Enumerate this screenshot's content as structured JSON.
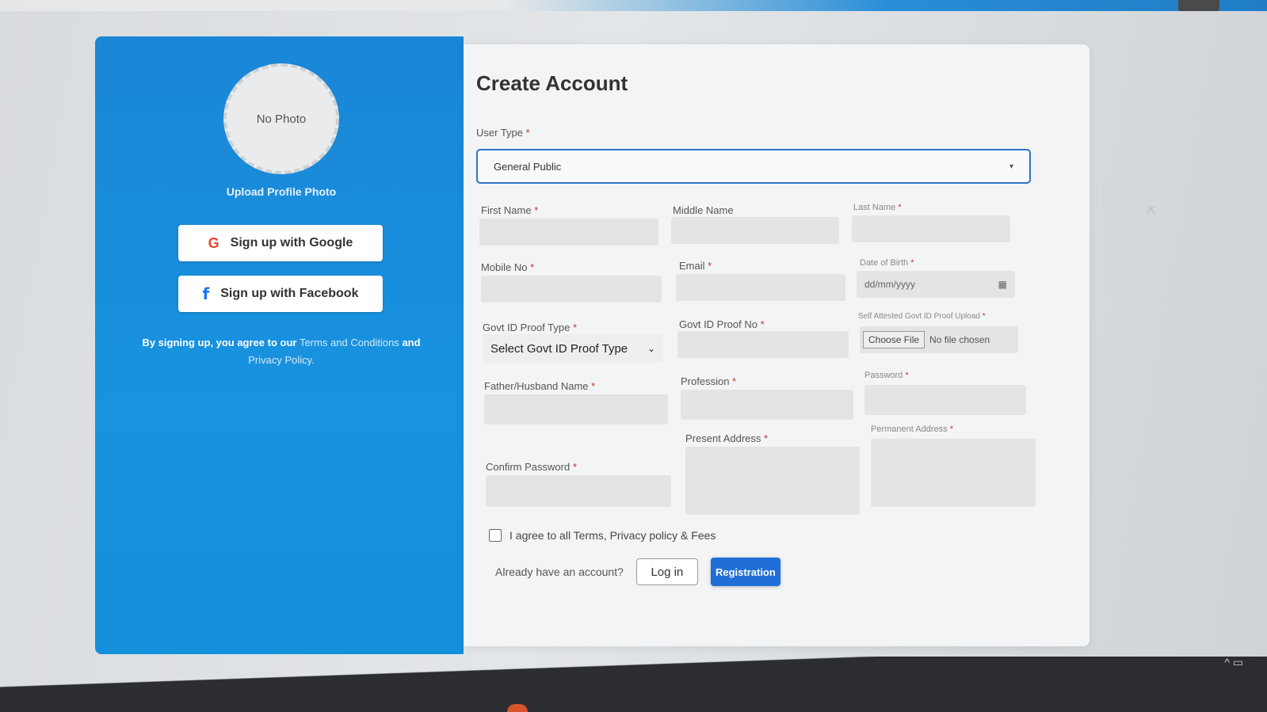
{
  "left_panel": {
    "photo_placeholder": "No Photo",
    "upload_label": "Upload Profile Photo",
    "google_button": "Sign up with Google",
    "google_icon": "G",
    "facebook_button": "Sign up with Facebook",
    "facebook_icon": "f",
    "agree_prefix": "By signing up, you agree to our",
    "terms_link": "Terms and Conditions",
    "agree_and": "and",
    "privacy_link": "Privacy Policy.",
    "accent_color": "#1793df"
  },
  "form": {
    "title": "Create Account",
    "user_type_label": "User Type",
    "user_type_value": "General Public",
    "required_marker": "*",
    "fields": {
      "first_name": "First Name",
      "middle_name": "Middle Name",
      "last_name": "Last Name",
      "mobile_no": "Mobile No",
      "email": "Email",
      "dob": "Date of Birth",
      "dob_placeholder": "dd/mm/yyyy",
      "govt_id_type": "Govt ID Proof Type",
      "govt_id_type_value": "Select Govt ID Proof Type",
      "govt_id_no": "Govt ID Proof No",
      "id_upload": "Self Attested Govt ID Proof Upload",
      "choose_file": "Choose File",
      "no_file": "No file chosen",
      "father_husband": "Father/Husband Name",
      "profession": "Profession",
      "password": "Password",
      "confirm_password": "Confirm Password",
      "present_address": "Present Address",
      "permanent_address": "Permanent Address"
    },
    "terms_checkbox": "I agree to all Terms, Privacy policy & Fees",
    "already_account": "Already have an account?",
    "login_button": "Log in",
    "register_button": "Registration",
    "primary_color": "#1f6fd6"
  }
}
